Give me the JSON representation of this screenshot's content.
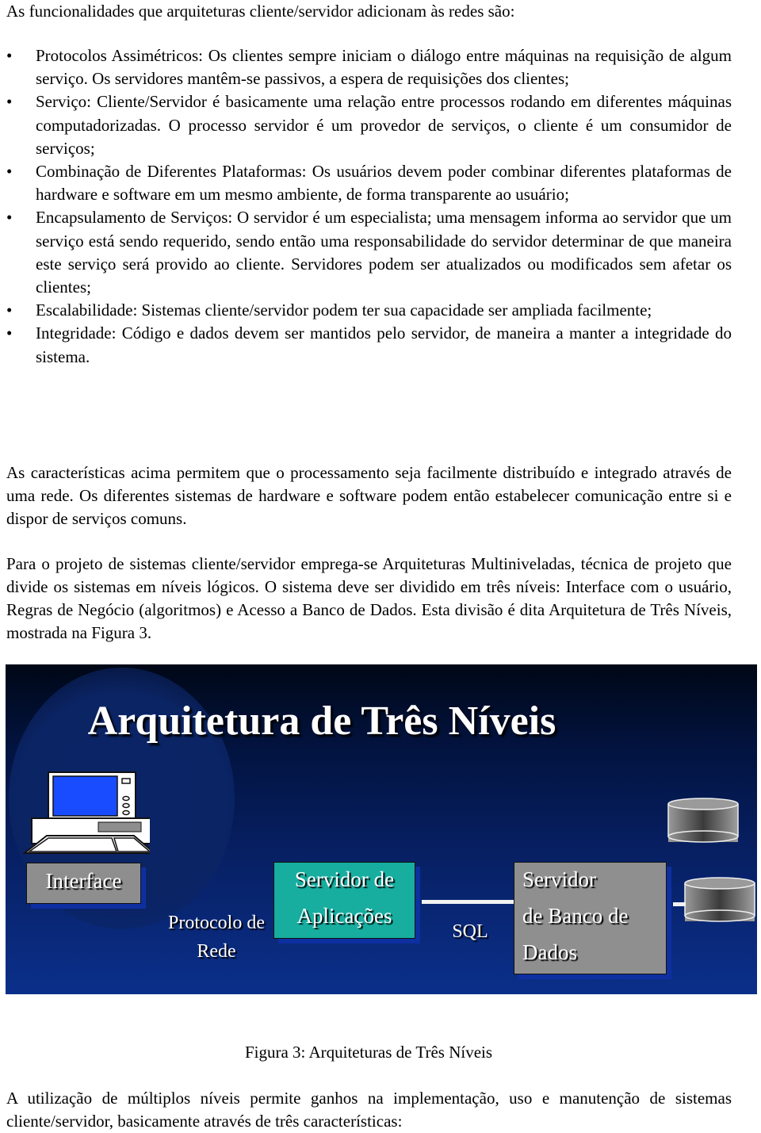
{
  "intro": "As funcionalidades que arquiteturas cliente/servidor adicionam às redes são:",
  "features": [
    {
      "bullet": "•",
      "text": "Protocolos Assimétricos: Os clientes sempre iniciam o diálogo entre máquinas na requisição de algum serviço. Os servidores mantêm-se passivos, a espera de requisições dos clientes;"
    },
    {
      "bullet": "•",
      "text": "Serviço: Cliente/Servidor é basicamente uma relação entre processos rodando em diferentes máquinas computadorizadas. O processo servidor é um provedor de serviços, o cliente é um consumidor de serviços;"
    },
    {
      "bullet": "•",
      "text": "Combinação de Diferentes Plataformas: Os usuários devem poder combinar diferentes plataformas de hardware e software em um mesmo ambiente, de forma transparente ao usuário;"
    },
    {
      "bullet": "•",
      "text": "Encapsulamento de Serviços: O servidor é um especialista; uma mensagem informa ao servidor que um serviço está sendo requerido, sendo então uma responsabilidade do servidor determinar de que maneira este serviço será provido ao cliente. Servidores podem ser atualizados ou modificados sem afetar os clientes;"
    },
    {
      "bullet": "•",
      "text": "Escalabilidade: Sistemas cliente/servidor podem ter sua capacidade ser ampliada facilmente;"
    },
    {
      "bullet": "•",
      "text": "Integridade: Código e dados devem ser mantidos pelo servidor, de maneira a manter a integridade do sistema."
    }
  ],
  "paragraph_2": "As características acima permitem que o processamento seja facilmente distribuído e integrado através de uma rede. Os diferentes sistemas de hardware e software podem então estabelecer comunicação entre si e dispor de serviços comuns.",
  "paragraph_3": "Para o projeto de sistemas cliente/servidor emprega-se Arquiteturas Multiniveladas, técnica de projeto que divide os sistemas em níveis lógicos. O sistema deve ser dividido em três níveis: Interface com o usuário, Regras de Negócio (algoritmos) e Acesso a Banco de Dados. Esta divisão é dita Arquitetura de Três Níveis, mostrada na Figura 3.",
  "figure": {
    "title": "Arquitetura de Três Níveis",
    "icons": {
      "client": "computer-icon",
      "database": "database-cylinder-icon"
    },
    "colors": {
      "interface_box": "#8e8e8e",
      "app_server_box": "#17aea0",
      "db_server_box": "#8f8f8f",
      "screen": "#1a4cff",
      "background_dark": "#000716",
      "background_light": "#0b2f8a"
    },
    "interface_label": "Interface",
    "protocol_label_line1": "Protocolo de",
    "protocol_label_line2": "Rede",
    "app_server_line1": "Servidor de",
    "app_server_line2": "Aplicações",
    "sql_label": "SQL",
    "db_server_line1": "Servidor",
    "db_server_line2": "de Banco de",
    "db_server_line3": "Dados"
  },
  "caption": "Figura 3: Arquiteturas de Três Níveis",
  "paragraph_4": "A utilização de múltiplos níveis permite ganhos na implementação, uso e manutenção de sistemas cliente/servidor, basicamente através de três características:"
}
